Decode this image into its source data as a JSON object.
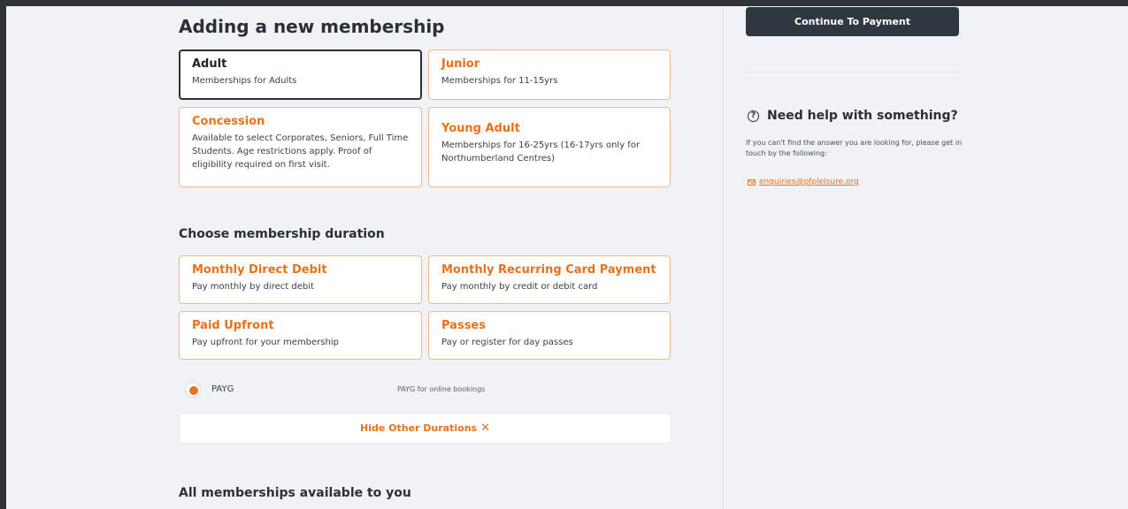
{
  "page_title": "Adding a new membership",
  "membership_types": [
    {
      "title": "Adult",
      "desc": "Memberships for Adults",
      "selected": true
    },
    {
      "title": "Junior",
      "desc": "Memberships for 11-15yrs"
    },
    {
      "title": "Concession",
      "desc": "Available to select Corporates, Seniors, Full Time Students. Age restrictions apply. Proof of eligibility required on first visit."
    },
    {
      "title": "Young Adult",
      "desc": "Memberships for 16-25yrs (16-17yrs only for Northumberland Centres)"
    }
  ],
  "duration_heading": "Choose membership duration",
  "durations": [
    {
      "title": "Monthly Direct Debit",
      "desc": "Pay monthly by direct debit"
    },
    {
      "title": "Monthly Recurring Card Payment",
      "desc": "Pay monthly by credit or debit card"
    },
    {
      "title": "Paid Upfront",
      "desc": "Pay upfront for your membership"
    },
    {
      "title": "Passes",
      "desc": "Pay or register for day passes"
    }
  ],
  "payg": {
    "label": "PAYG",
    "desc": "PAYG for online bookings",
    "selected": true
  },
  "hide_durations_label": "Hide Other Durations",
  "hide_durations_icon": "close-icon",
  "all_memberships_heading": "All memberships available to you",
  "sidebar": {
    "continue_label": "Continue To Payment",
    "help_icon": "question-circle-icon",
    "help_title": "Need help with something?",
    "help_text": "If you can't find the answer you are looking for, please get in touch by the following:",
    "email_icon": "mail-icon",
    "email": "enquiries@pfpleisure.org"
  },
  "colors": {
    "accent": "#e8711a",
    "dark": "#2f3740",
    "background": "#f0f2f5"
  }
}
